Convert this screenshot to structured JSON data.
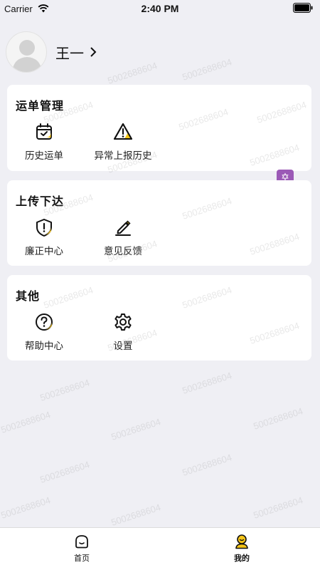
{
  "status_bar": {
    "carrier": "Carrier",
    "time": "2:40 PM"
  },
  "profile": {
    "name": "王一"
  },
  "sections": [
    {
      "title": "运单管理",
      "items": [
        {
          "label": "历史运单",
          "icon": "calendar-check-icon"
        },
        {
          "label": "异常上报历史",
          "icon": "warning-icon"
        }
      ]
    },
    {
      "title": "上传下达",
      "items": [
        {
          "label": "廉正中心",
          "icon": "shield-alert-icon"
        },
        {
          "label": "意见反馈",
          "icon": "pen-icon"
        }
      ]
    },
    {
      "title": "其他",
      "items": [
        {
          "label": "帮助中心",
          "icon": "help-circle-icon"
        },
        {
          "label": "设置",
          "icon": "gear-icon"
        }
      ]
    }
  ],
  "watermark": "50026886​04",
  "tabs": [
    {
      "label": "首页",
      "icon": "home-face-icon",
      "active": false
    },
    {
      "label": "我的",
      "icon": "user-icon",
      "active": true
    }
  ],
  "colors": {
    "accent": "#f5c518",
    "background": "#efeff4",
    "card": "#ffffff"
  }
}
